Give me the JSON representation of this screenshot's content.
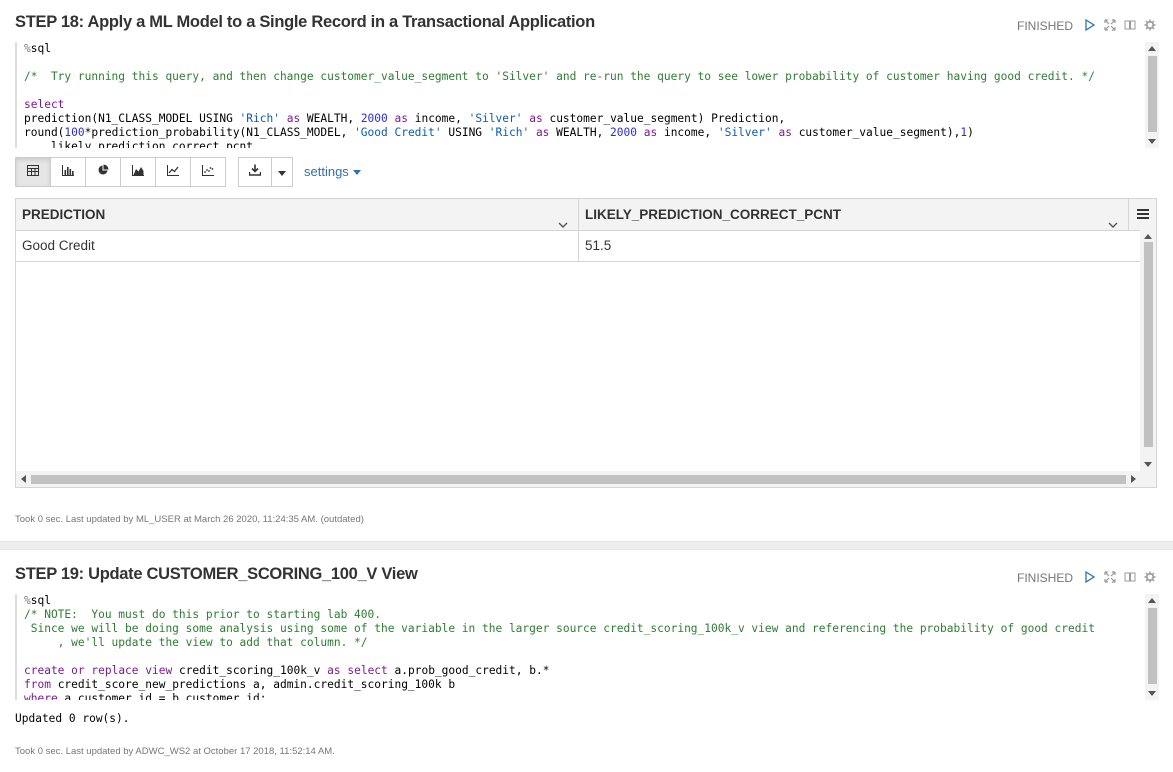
{
  "paragraph1": {
    "title": "STEP 18: Apply a ML Model to a Single Record in a Transactional Application",
    "status": "FINISHED",
    "code": {
      "l1": "sql",
      "l3": "/*  Try running this query, and then change customer_value_segment to 'Silver' and re-run the query to see lower probability of customer having good credit. */",
      "l5": "select",
      "l6a": "prediction(N1_CLASS_MODEL USING ",
      "l6b": "'Rich'",
      "l6c": " as ",
      "l6d": "WEALTH, ",
      "l6e": "2000",
      "l6f": " as ",
      "l6g": "income, ",
      "l6h": "'Silver'",
      "l6i": " as ",
      "l6j": "customer_value_segment) Prediction,",
      "l7a": "round(",
      "l7b": "100",
      "l7c": "*prediction_probability(N1_CLASS_MODEL, ",
      "l7d": "'Good Credit'",
      "l7e": " USING ",
      "l7f": "'Rich'",
      "l7g": " as ",
      "l7h": "WEALTH, ",
      "l7i": "2000",
      "l7j": " as ",
      "l7k": "income, ",
      "l7l": "'Silver'",
      "l7m": " as ",
      "l7n": "customer_value_segment),",
      "l7o": "1",
      "l7p": ")",
      "l8": "    likely_prediction_correct_pcnt"
    },
    "toolbar": {
      "settings_label": "settings"
    },
    "table": {
      "columns": [
        "PREDICTION",
        "LIKELY_PREDICTION_CORRECT_PCNT"
      ],
      "rows": [
        [
          "Good Credit",
          "51.5"
        ]
      ]
    },
    "footer": "Took 0 sec. Last updated by ML_USER at March 26 2020, 11:24:35 AM. (outdated)"
  },
  "paragraph2": {
    "title": "STEP 19: Update CUSTOMER_SCORING_100_V View",
    "status": "FINISHED",
    "code": {
      "l1": "sql",
      "l2": "/* NOTE:  You must do this prior to starting lab 400.",
      "l3": " Since we will be doing some analysis using some of the variable in the larger source credit_scoring_100k_v view and referencing the probability of good credit",
      "l4": "     , we'll update the view to add that column. */",
      "l6a": "create",
      "l6b": " or ",
      "l6c": "replace",
      "l6d": " view",
      "l6e": " credit_scoring_100k_v ",
      "l6f": "as",
      "l6g": " select",
      "l6h": " a.prob_good_credit, b.*",
      "l7a": "from",
      "l7b": " credit_score_new_predictions a, admin.credit_scoring_100k b",
      "l8a": "where",
      "l8b": " a.customer_id = b.customer_id;"
    },
    "result": "Updated 0 row(s).",
    "footer": "Took 0 sec. Last updated by ADWC_WS2 at October 17 2018, 11:52:14 AM."
  },
  "icons": [
    "run-icon",
    "expand-icon",
    "book-icon",
    "gear-icon",
    "table-icon",
    "bar-chart-icon",
    "pie-chart-icon",
    "area-chart-icon",
    "line-chart-icon",
    "scatter-chart-icon",
    "download-icon",
    "caret-down-icon",
    "chevron-down-icon",
    "menu-icon"
  ],
  "colors": {
    "link": "#3071a9",
    "keyword": "#7c1a8e",
    "string": "#0b5cad",
    "comment": "#2e7d32",
    "number": "#2b2bd6"
  }
}
